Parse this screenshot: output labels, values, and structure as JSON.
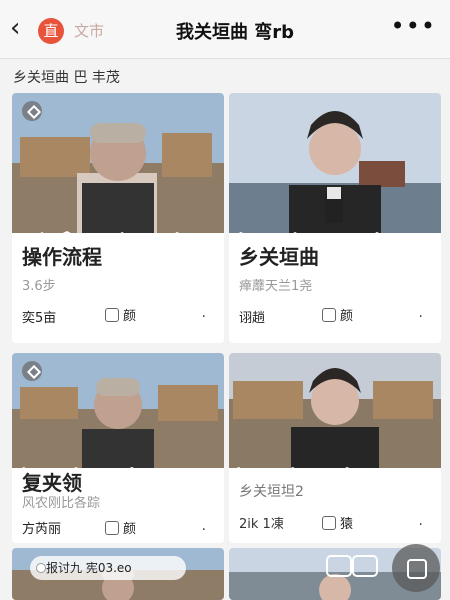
{
  "header": {
    "title": "我关垣曲 弯rb",
    "live_tag": "直",
    "city": "文市",
    "more": "•••"
  },
  "section_title": "乡关垣曲 巴 丰茂",
  "cards": [
    {
      "overlay_title": "操作流程",
      "meta": "3.6步",
      "author": "奕5亩",
      "like": "颜",
      "dot": "."
    },
    {
      "overlay_title": "乡关垣曲",
      "meta": "瘅蘼天兰1尧",
      "author": "诩趟",
      "like": "颜",
      "dot": "."
    },
    {
      "overlay_title": "复夹领",
      "meta": "风农刚比各踪",
      "author": "方芮丽",
      "like": "颜",
      "dot": "."
    },
    {
      "overlay_title": "乡关垣坦2",
      "meta": "2ik 1凍",
      "author": "",
      "like": "猿",
      "dot": "."
    }
  ],
  "bottom": {
    "tag": "报讨九 宪03.eo"
  }
}
